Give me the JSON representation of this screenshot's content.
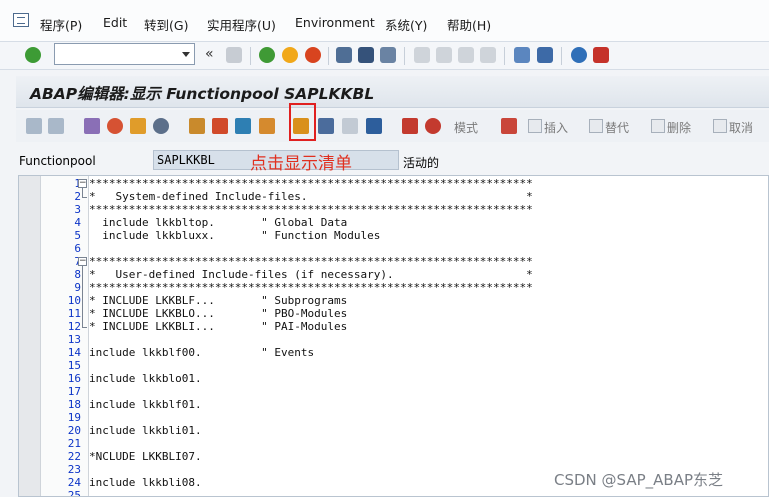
{
  "menubar": {
    "items": [
      "程序(P)",
      "Edit",
      "转到(G)",
      "实用程序(U)",
      "Environment",
      "系统(Y)",
      "帮助(H)"
    ]
  },
  "toolbar": {
    "command_field_value": "",
    "back_symbol": "«"
  },
  "title": "ABAP编辑器:显示 Functionpool SAPLKKBL",
  "app_toolbar": {
    "pattern_label": "模式",
    "insert_label": "插入",
    "replace_label": "替代",
    "delete_label": "删除",
    "cancel_label": "取消"
  },
  "annotation": "点击显示清单",
  "field": {
    "label": "Functionpool",
    "value": "SAPLKKBL",
    "status": "活动的"
  },
  "editor": {
    "lines": [
      {
        "n": "1",
        "text": "*******************************************************************"
      },
      {
        "n": "2",
        "text": "*   System-defined Include-files.                                 *"
      },
      {
        "n": "3",
        "text": "*******************************************************************"
      },
      {
        "n": "4",
        "text": "  include lkkbltop.       \" Global Data"
      },
      {
        "n": "5",
        "text": "  include lkkbluxx.       \" Function Modules"
      },
      {
        "n": "6",
        "text": ""
      },
      {
        "n": "7",
        "text": "*******************************************************************"
      },
      {
        "n": "8",
        "text": "*   User-defined Include-files (if necessary).                    *"
      },
      {
        "n": "9",
        "text": "*******************************************************************"
      },
      {
        "n": "10",
        "text": "* INCLUDE LKKBLF...       \" Subprograms"
      },
      {
        "n": "11",
        "text": "* INCLUDE LKKBLO...       \" PBO-Modules"
      },
      {
        "n": "12",
        "text": "* INCLUDE LKKBLI...       \" PAI-Modules"
      },
      {
        "n": "13",
        "text": ""
      },
      {
        "n": "14",
        "text": "include lkkblf00.         \" Events"
      },
      {
        "n": "15",
        "text": ""
      },
      {
        "n": "16",
        "text": "include lkkblo01."
      },
      {
        "n": "17",
        "text": ""
      },
      {
        "n": "18",
        "text": "include lkkblf01."
      },
      {
        "n": "19",
        "text": ""
      },
      {
        "n": "20",
        "text": "include lkkbli01."
      },
      {
        "n": "21",
        "text": ""
      },
      {
        "n": "22",
        "text": "*NCLUDE LKKBLI07."
      },
      {
        "n": "23",
        "text": ""
      },
      {
        "n": "24",
        "text": "include lkkbli08."
      },
      {
        "n": "25",
        "text": ""
      }
    ]
  },
  "watermark": "CSDN @SAP_ABAP东芝",
  "colors": {
    "line_number": "#0c34c7",
    "highlight_box": "#e02020",
    "annotation": "#e03020"
  }
}
